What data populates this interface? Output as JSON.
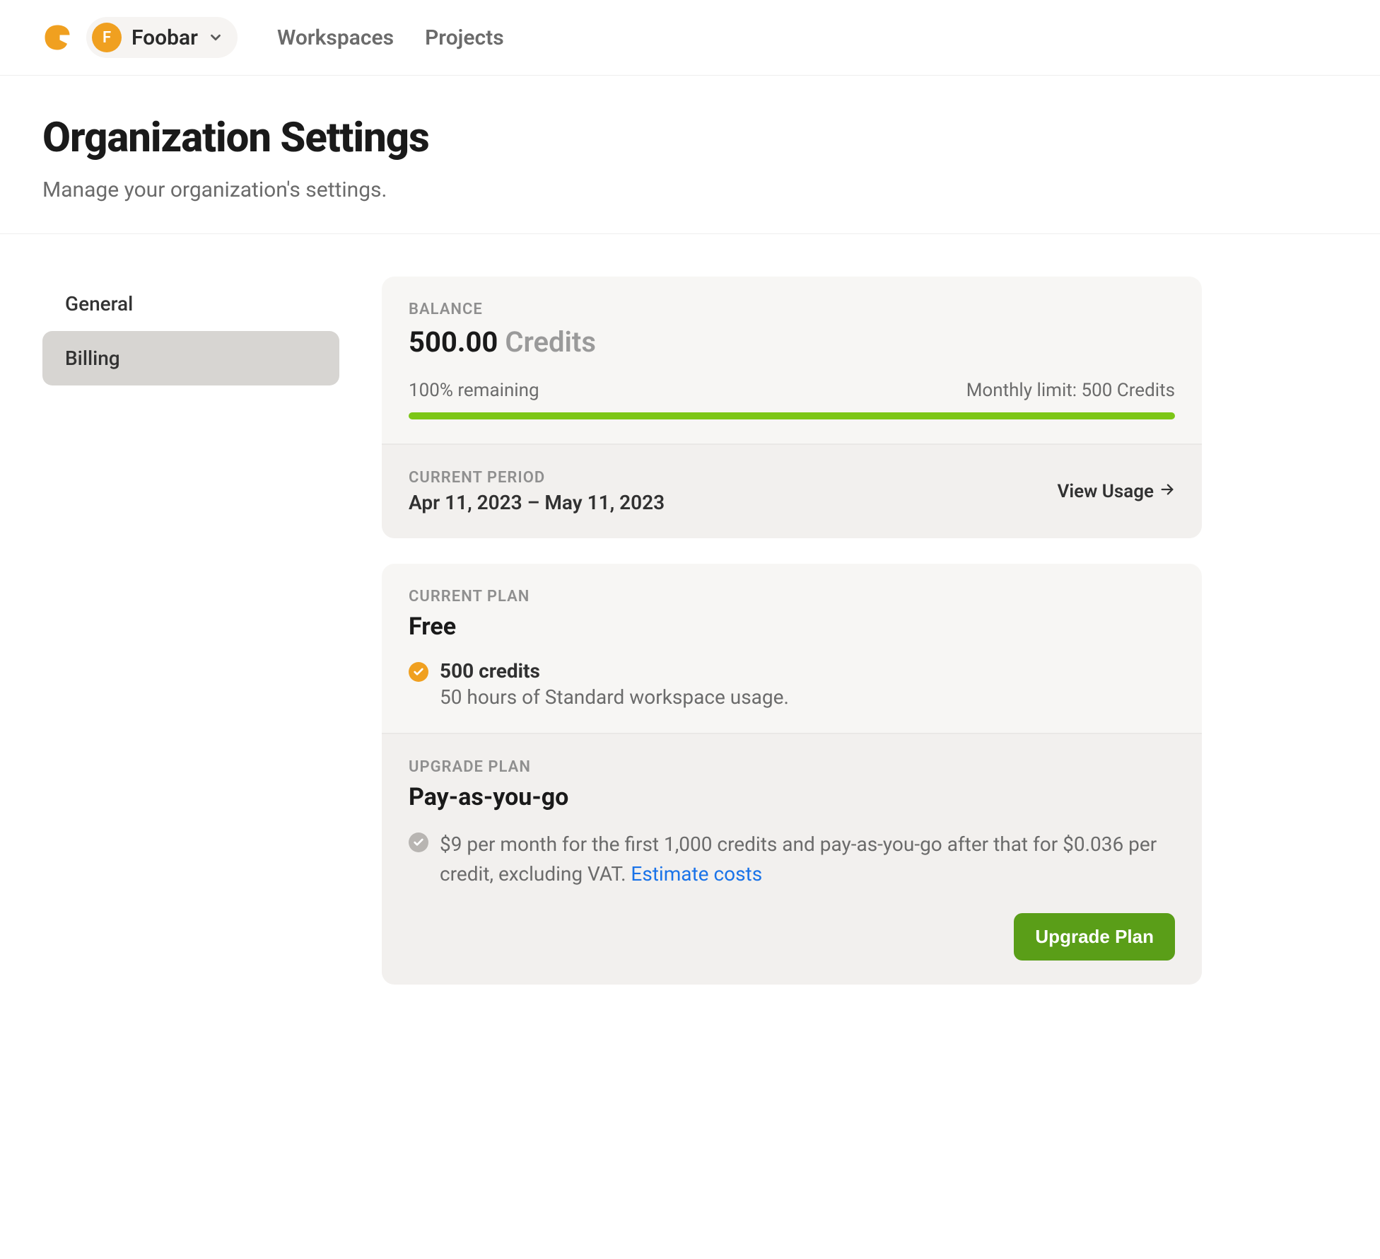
{
  "header": {
    "org_initial": "F",
    "org_name": "Foobar",
    "nav": {
      "workspaces": "Workspaces",
      "projects": "Projects"
    }
  },
  "page": {
    "title": "Organization Settings",
    "subtitle": "Manage your organization's settings."
  },
  "sidebar": {
    "items": [
      {
        "label": "General"
      },
      {
        "label": "Billing"
      }
    ]
  },
  "billing": {
    "balance": {
      "eyebrow": "BALANCE",
      "amount": "500.00",
      "unit": "Credits",
      "remaining_text": "100% remaining",
      "limit_text": "Monthly limit: 500 Credits",
      "progress_percent": 100
    },
    "period": {
      "eyebrow": "CURRENT PERIOD",
      "dates": "Apr 11, 2023 – May 11, 2023",
      "view_usage": "View Usage"
    },
    "current_plan": {
      "eyebrow": "CURRENT PLAN",
      "name": "Free",
      "feature_title": "500 credits",
      "feature_desc": "50 hours of Standard workspace usage."
    },
    "upgrade_plan": {
      "eyebrow": "UPGRADE PLAN",
      "name": "Pay-as-you-go",
      "desc": "$9 per month for the first 1,000 credits and pay-as-you-go after that for $0.036 per credit, excluding VAT. ",
      "estimate_link": "Estimate costs",
      "button": "Upgrade Plan"
    }
  }
}
